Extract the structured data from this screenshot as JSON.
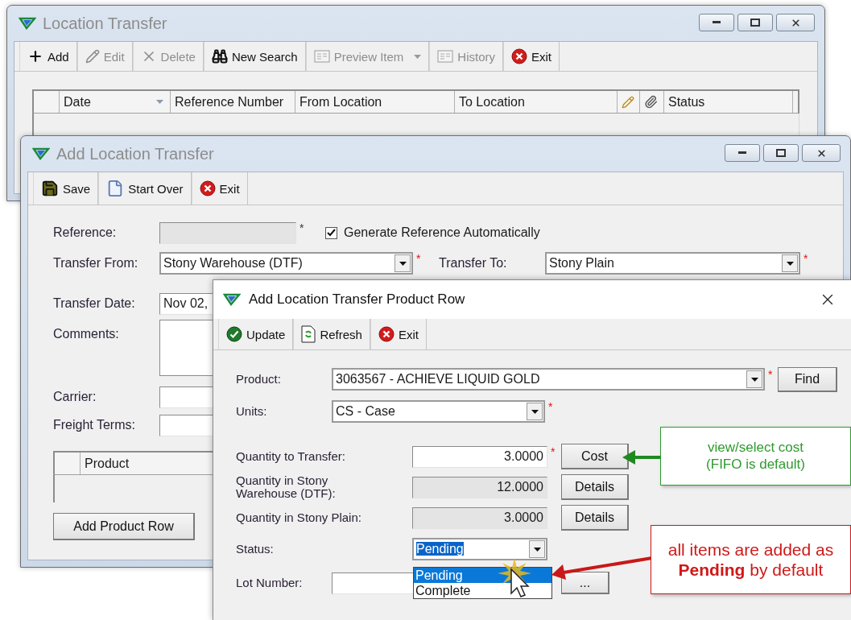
{
  "location_transfer_window": {
    "title": "Location Transfer",
    "active": false,
    "toolbar": [
      {
        "label": "Add",
        "disabled": false
      },
      {
        "label": "Edit",
        "disabled": true
      },
      {
        "label": "Delete",
        "disabled": true
      },
      {
        "label": "New Search",
        "disabled": false
      },
      {
        "label": "Preview Item",
        "disabled": true,
        "menu": true
      },
      {
        "label": "History",
        "disabled": true
      },
      {
        "label": "Exit",
        "disabled": false
      }
    ],
    "columns": [
      {
        "kind": "blank"
      },
      {
        "kind": "text",
        "label": "Date",
        "sorted": true
      },
      {
        "kind": "text",
        "label": "Reference Number",
        "sorted": false
      },
      {
        "kind": "text",
        "label": "From Location",
        "sorted": false
      },
      {
        "kind": "text",
        "label": "To Location",
        "sorted": false
      },
      {
        "kind": "pencil"
      },
      {
        "kind": "clip"
      },
      {
        "kind": "text",
        "label": "Status",
        "sorted": false
      }
    ]
  },
  "add_transfer_window": {
    "title": "Add Location Transfer",
    "active": false,
    "toolbar": [
      {
        "label": "Save",
        "disabled": false
      },
      {
        "label": "Start Over",
        "disabled": false
      },
      {
        "label": "Exit",
        "disabled": false
      }
    ],
    "reference": {
      "label": "Reference:",
      "mark": "*"
    },
    "generate_reference": {
      "label": "Generate Reference Automatically",
      "checked": true
    },
    "transfer_from": {
      "label": "Transfer From:",
      "value": "Stony Warehouse (DTF)",
      "mark": "*"
    },
    "transfer_to": {
      "label": "Transfer To:",
      "value": "Stony Plain",
      "mark": "*"
    },
    "transfer_date": {
      "label": "Transfer Date:",
      "value": "Nov 02,"
    },
    "comments": {
      "label": "Comments:"
    },
    "carrier": {
      "label": "Carrier:"
    },
    "freight_terms": {
      "label": "Freight Terms:"
    },
    "product_grid": {
      "columns": [
        "Product"
      ]
    },
    "add_row_button": "Add Product Row"
  },
  "product_row_dialog": {
    "title": "Add Location Transfer Product Row",
    "active": true,
    "toolbar": [
      {
        "label": "Update",
        "disabled": false
      },
      {
        "label": "Refresh",
        "disabled": false
      },
      {
        "label": "Exit",
        "disabled": false
      }
    ],
    "product": {
      "label": "Product:",
      "value": "3063567 - ACHIEVE LIQUID GOLD",
      "mark": "*",
      "button": "Find"
    },
    "units": {
      "label": "Units:",
      "value": "CS - Case",
      "mark": "*"
    },
    "quantities": [
      {
        "label": "Quantity to Transfer:",
        "value": "3.0000",
        "editable": true,
        "mark": "*",
        "button": "Cost"
      },
      {
        "label": "Quantity in Stony Warehouse (DTF):",
        "value": "12.0000",
        "editable": false,
        "button": "Details"
      },
      {
        "label": "Quantity in Stony Plain:",
        "value": "3.0000",
        "editable": false,
        "button": "Details"
      }
    ],
    "status": {
      "label": "Status:",
      "value": "Pending",
      "options": [
        {
          "label": "Pending",
          "selected": true
        },
        {
          "label": "Complete",
          "selected": false
        }
      ]
    },
    "lot_number": {
      "label": "Lot Number:",
      "button": "..."
    }
  },
  "callouts": [
    {
      "text": "view/select cost\n(FIFO is default)",
      "color": "#2e9a2e"
    },
    {
      "text": "all items are added as\n**Pending** by default",
      "color": "#d01818"
    }
  ]
}
